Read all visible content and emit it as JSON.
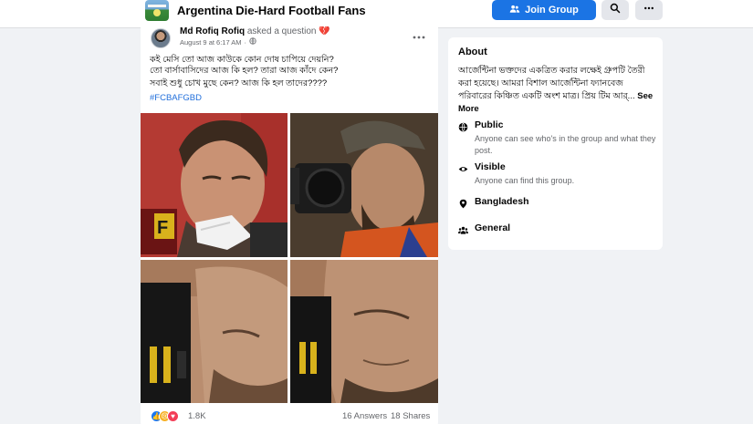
{
  "group": {
    "title": "Argentina Die-Hard Football Fans",
    "join_label": "Join Group",
    "join_icon": "people-icon",
    "search_icon": "search-icon",
    "more_icon": "more-icon"
  },
  "post": {
    "author": "Md Rofiq Rofiq",
    "action": "asked a question",
    "date": "August 9 at 6:17 AM",
    "date_separator": "·",
    "privacy_icon": "globe-icon",
    "lines": [
      "কই মেসি তো আজ কাউকে কোন  দোষ চাপিয়ে দেয়নি?",
      "তো বার্সাবাসিদের আজ কি হল?  তারা আজ কাঁদে কেন?",
      "সবাই শুধু চোখ মুছে কেন?  আজ কি হল তাদের????"
    ],
    "hashtag": "#FCBAFGBD",
    "photos": [
      "messi-crying-with-tissue",
      "photographer-crying-behind-camera",
      "photographer-closeup-camera",
      "photographer-closeup-tears"
    ],
    "reaction_count": "1.8K",
    "reaction_icons": [
      "like-icon",
      "sad-icon",
      "love-icon"
    ],
    "answers": "16 Answers",
    "shares": "18 Shares"
  },
  "about": {
    "title": "About",
    "description": "আর্জেন্টিনা ভক্তদের একত্রিত করার লক্ষেই গ্রুপটি তৈরী করা হয়েছে। আমরা বিশাল আর্জেন্টিনা ফ্যানবেজ পরিবারের কিঞ্চিত একটি অংশ মাত্র। প্রিয় টিম আর্...",
    "see_more": "See More",
    "rows": [
      {
        "icon": "globe-icon",
        "label": "Public",
        "sub": "Anyone can see who's in the group and what they post."
      },
      {
        "icon": "eye-icon",
        "label": "Visible",
        "sub": "Anyone can find this group."
      },
      {
        "icon": "location-icon",
        "label": "Bangladesh",
        "sub": ""
      },
      {
        "icon": "group-icon",
        "label": "General",
        "sub": ""
      }
    ]
  },
  "colors": {
    "accent": "#1b74e4",
    "hashtag": "#216fdb",
    "muted": "#65676b",
    "background": "#f0f2f5"
  }
}
